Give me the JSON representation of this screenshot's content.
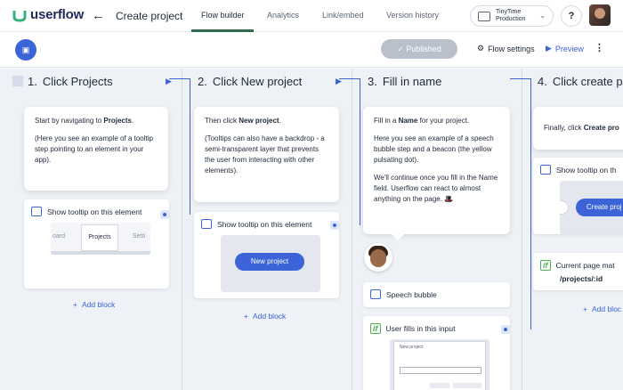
{
  "brand": {
    "name": "userflow",
    "accent": "#3c63d8",
    "green": "#2f6b4f"
  },
  "header": {
    "back_icon": "arrow-left-icon",
    "project_title": "Create project",
    "tabs": [
      {
        "label": "Flow builder",
        "active": true
      },
      {
        "label": "Analytics"
      },
      {
        "label": "Link/embed"
      },
      {
        "label": "Version history"
      }
    ],
    "company": {
      "line1": "TinyTime",
      "line2": "Production"
    },
    "help_label": "?"
  },
  "toolbar": {
    "published_label": "Published",
    "flow_settings_label": "Flow settings",
    "preview_label": "Preview"
  },
  "steps": [
    {
      "number": "1.",
      "title": "Click Projects",
      "tooltip": {
        "p1_prefix": "Start by navigating to ",
        "p1_bold": "Projects",
        "p1_suffix": ".",
        "p2": "(Here you see an example of a tooltip step pointing to an element in your app)."
      },
      "block_label": "Show tooltip on this element",
      "thumb_tabs": [
        "oard",
        "Projects",
        "Setti"
      ],
      "add_block": "Add block"
    },
    {
      "number": "2.",
      "title": "Click New project",
      "tooltip": {
        "p1_prefix": "Then click ",
        "p1_bold": "New project",
        "p1_suffix": ".",
        "p2": "(Tooltips can also have a backdrop - a semi-transparent layer that prevents the user from interacting with other elements)."
      },
      "block_label": "Show tooltip on this element",
      "thumb_button": "New project",
      "add_block": "Add block"
    },
    {
      "number": "3.",
      "title": "Fill in name",
      "tooltip": {
        "p1_prefix": "Fill in a ",
        "p1_bold": "Name",
        "p1_suffix": " for your project.",
        "p2": "Here you see an example of a speech bubble step and a beacon (the yellow pulsating dot).",
        "p3": "We'll continue once you fill in the Name field. Userflow can react to almost anything on the page. 🎩"
      },
      "speech_label": "Speech bubble",
      "condition_label": "User fills in this input",
      "thumb_modal_title": "New project"
    },
    {
      "number": "4.",
      "title": "Click create p",
      "tooltip": {
        "p1_prefix": "Finally, click ",
        "p1_bold": "Create pro",
        "p1_suffix": ""
      },
      "block_label": "Show tooltip on th",
      "thumb_button": "Create proj",
      "condition_label": "Current page mat",
      "condition_value": "/projects/:id",
      "add_block": "Add bloc"
    }
  ]
}
